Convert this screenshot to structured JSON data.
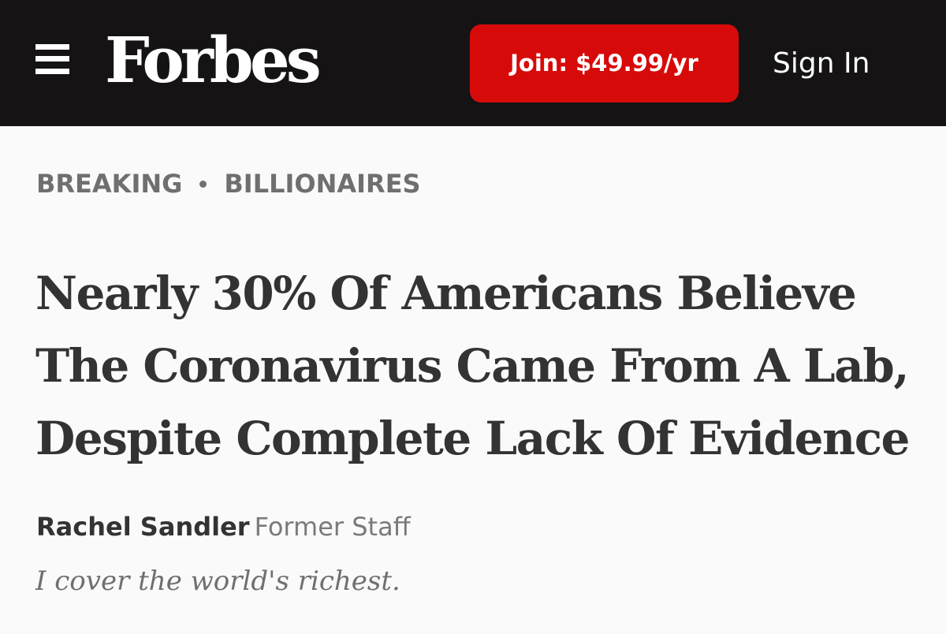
{
  "header": {
    "menu_icon": "hamburger-menu-icon",
    "logo_text": "Forbes",
    "join_label": "Join: $49.99/yr",
    "signin_label": "Sign In",
    "colors": {
      "bar": "#151314",
      "join_button": "#d70a0a"
    }
  },
  "article": {
    "kicker": {
      "label_breaking": "BREAKING",
      "label_section": "BILLIONAIRES"
    },
    "headline": "Nearly 30% Of Americans Believe The Coronavirus Came From A Lab, Despite Complete Lack Of Evidence",
    "author": {
      "name": "Rachel Sandler",
      "role": "Former Staff",
      "tagline": "I cover the world's richest."
    }
  }
}
